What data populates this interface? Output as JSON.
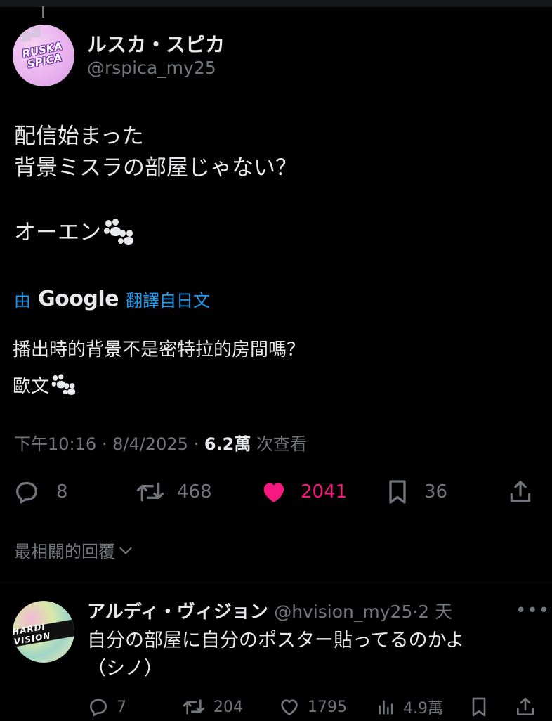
{
  "tweet": {
    "author_name": "ルスカ・スピカ",
    "author_handle": "@rspica_my25",
    "avatar_text_line1": "RUSKA",
    "avatar_text_line2": "SPICA",
    "text_line1": "配信始まった",
    "text_line2": "背景ミスラの部屋じゃない？",
    "text_line3": "オーエン",
    "translation_prefix": "由",
    "translation_brand": "Google",
    "translation_suffix": "翻譯自日文",
    "translated_line1": "播出時的背景不是密特拉的房間嗎？",
    "translated_line2": "歐文",
    "time": "下午10:16",
    "date": "8/4/2025",
    "separator": "·",
    "views_count": "6.2萬",
    "views_label": "次查看"
  },
  "actions": {
    "replies": "8",
    "retweets": "468",
    "likes": "2041",
    "bookmarks": "36"
  },
  "replies_header": "最相關的回覆",
  "reply": {
    "author_name": "アルディ・ヴィジョン",
    "author_handle": "@hvision_my25",
    "time": "2 天",
    "separator": "·",
    "more": "•••",
    "avatar_text": "HARDI VISION",
    "text_line1": "自分の部屋に自分のポスター貼ってるのかよ",
    "text_line2": "（シノ）",
    "replies": "7",
    "retweets": "204",
    "likes": "1795",
    "views": "4.9萬"
  },
  "colors": {
    "background": "#000000",
    "text": "#e7e9ea",
    "muted": "#71767b",
    "link": "#1d9bf0",
    "like": "#f91880"
  },
  "icons": [
    "reply-icon",
    "retweet-icon",
    "heart-icon",
    "bookmark-icon",
    "share-icon",
    "chevron-down-icon",
    "paw-icon",
    "views-icon",
    "more-icon"
  ]
}
